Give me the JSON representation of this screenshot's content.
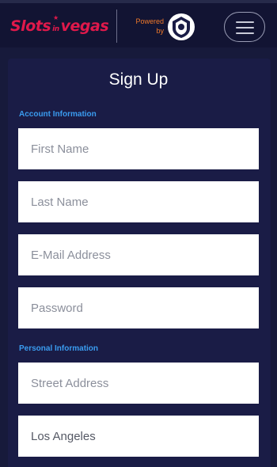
{
  "header": {
    "logo": {
      "part1": "Slots",
      "part2": "in",
      "part3": "vegas",
      "star": "★"
    },
    "powered_line1": "Powered",
    "powered_line2": "by",
    "brand_icon": "shield-logo-icon",
    "menu_icon": "hamburger-icon"
  },
  "form": {
    "title": "Sign Up",
    "sections": {
      "account": "Account Information",
      "personal": "Personal Information"
    },
    "fields": {
      "first_name": {
        "placeholder": "First Name",
        "value": ""
      },
      "last_name": {
        "placeholder": "Last Name",
        "value": ""
      },
      "email": {
        "placeholder": "E-Mail Address",
        "value": ""
      },
      "password": {
        "placeholder": "Password",
        "value": ""
      },
      "street": {
        "placeholder": "Street Address",
        "value": ""
      },
      "city": {
        "placeholder": "",
        "value": "Los Angeles"
      }
    }
  },
  "colors": {
    "background": "#171a3b",
    "header": "#121433",
    "card": "#1a1c46",
    "brand_red": "#e0194b",
    "accent_blue": "#3a9cf0",
    "powered_orange": "#f0792a"
  }
}
